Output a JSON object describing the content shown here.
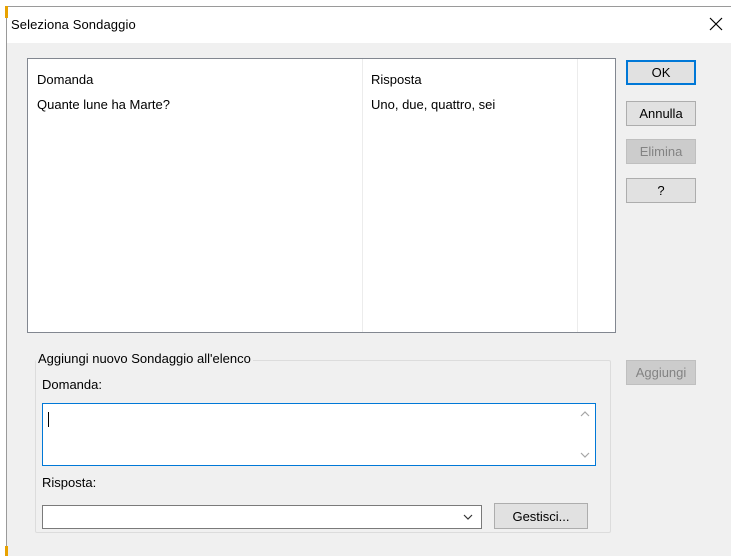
{
  "window": {
    "title": "Seleziona Sondaggio",
    "close_icon": "close-icon"
  },
  "list": {
    "columns": [
      "Domanda",
      "Risposta"
    ],
    "rows": [
      {
        "question": "Quante lune ha Marte?",
        "answer": "Uno, due, quattro, sei"
      }
    ]
  },
  "buttons": {
    "ok": "OK",
    "cancel": "Annulla",
    "delete": "Elimina",
    "help": "?",
    "add": "Aggiungi",
    "manage": "Gestisci..."
  },
  "add_group": {
    "title": "Aggiungi nuovo Sondaggio all'elenco",
    "question_label": "Domanda:",
    "question_value": "",
    "answer_label": "Risposta:",
    "answer_value": ""
  },
  "colors": {
    "accent": "#0078d7",
    "dialog_bg": "#f0f0f0"
  }
}
